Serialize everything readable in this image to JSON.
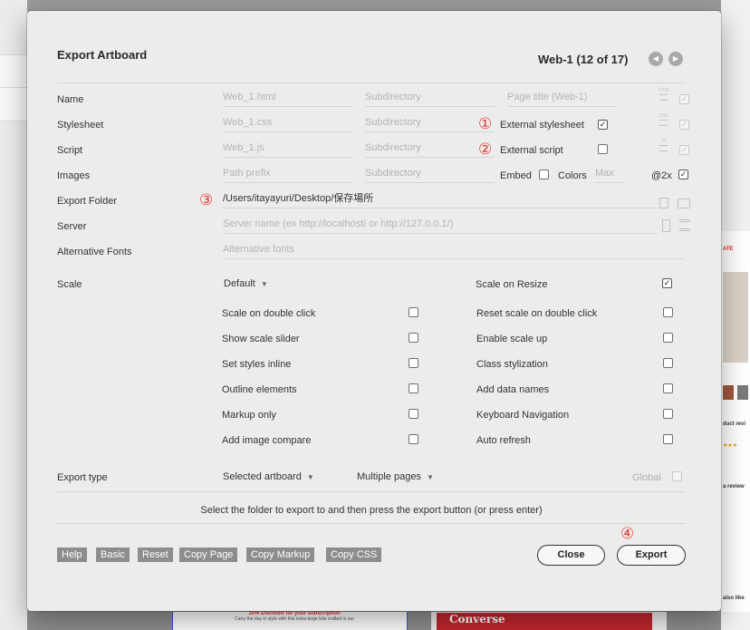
{
  "dialog": {
    "title": "Export Artboard",
    "page_info": "Web-1 (12 of 17)",
    "prev_icon": "◀",
    "next_icon": "▶"
  },
  "rows": {
    "name": {
      "label": "Name",
      "value_placeholder": "Web_1.html",
      "subdir_placeholder": "Subdirectory",
      "page_title_placeholder": "Page title (Web-1)"
    },
    "stylesheet": {
      "label": "Stylesheet",
      "value_placeholder": "Web_1.css",
      "subdir_placeholder": "Subdirectory",
      "option_label": "External stylesheet",
      "option_checked": true,
      "annotation": "①"
    },
    "script": {
      "label": "Script",
      "value_placeholder": "Web_1.js",
      "subdir_placeholder": "Subdirectory",
      "option_label": "External script",
      "option_checked": false,
      "annotation": "②"
    },
    "images": {
      "label": "Images",
      "value_placeholder": "Path prefix",
      "subdir_placeholder": "Subdirectory",
      "embed_label": "Embed",
      "embed_checked": false,
      "colors_label": "Colors",
      "max_placeholder": "Max",
      "retina_label": "@2x",
      "retina_checked": true
    },
    "export_folder": {
      "label": "Export Folder",
      "value": "/Users/itayayuri/Desktop/保存場所",
      "annotation": "③"
    },
    "server": {
      "label": "Server",
      "value_placeholder": "Server name (ex http://localhost/ or http://127.0.0.1/)"
    },
    "alt_fonts": {
      "label": "Alternative Fonts",
      "value_placeholder": "Alternative fonts"
    }
  },
  "mini_icons": {
    "html": "HTM",
    "css": "CSS",
    "js": "JS"
  },
  "scale": {
    "label": "Scale",
    "value": "Default",
    "scale_on_resize_label": "Scale on Resize",
    "scale_on_resize_checked": true
  },
  "options_left": [
    {
      "label": "Scale on double click",
      "checked": false
    },
    {
      "label": "Show scale slider",
      "checked": false
    },
    {
      "label": "Set styles inline",
      "checked": false
    },
    {
      "label": "Outline elements",
      "checked": false
    },
    {
      "label": "Markup only",
      "checked": false
    },
    {
      "label": "Add image compare",
      "checked": false
    }
  ],
  "options_right": [
    {
      "label": "Reset scale on double click",
      "checked": false
    },
    {
      "label": "Enable scale up",
      "checked": false
    },
    {
      "label": "Class stylization",
      "checked": false
    },
    {
      "label": "Add data names",
      "checked": false
    },
    {
      "label": "Keyboard Navigation",
      "checked": false
    },
    {
      "label": "Auto refresh",
      "checked": false
    }
  ],
  "export_type": {
    "label": "Export type",
    "selected": "Selected artboard",
    "pages": "Multiple pages",
    "global_label": "Global",
    "global_checked": false
  },
  "hint": "Select the folder to export to and then press the export button (or press enter)",
  "toolbar": [
    "Help",
    "Basic",
    "Reset",
    "Copy Page",
    "Copy Markup",
    "Copy CSS"
  ],
  "buttons": {
    "close": "Close",
    "export": "Export",
    "export_annotation": "④"
  },
  "background": {
    "promo_text": "10% Discount for your subscription",
    "promo_sub": "Carry the day in style with this extra-large tote crafted in our",
    "banner_text": "Converse",
    "side_texts": [
      "ATE",
      "duct revi",
      "★★★",
      "a review",
      "also like"
    ]
  },
  "check_mark": "✓"
}
